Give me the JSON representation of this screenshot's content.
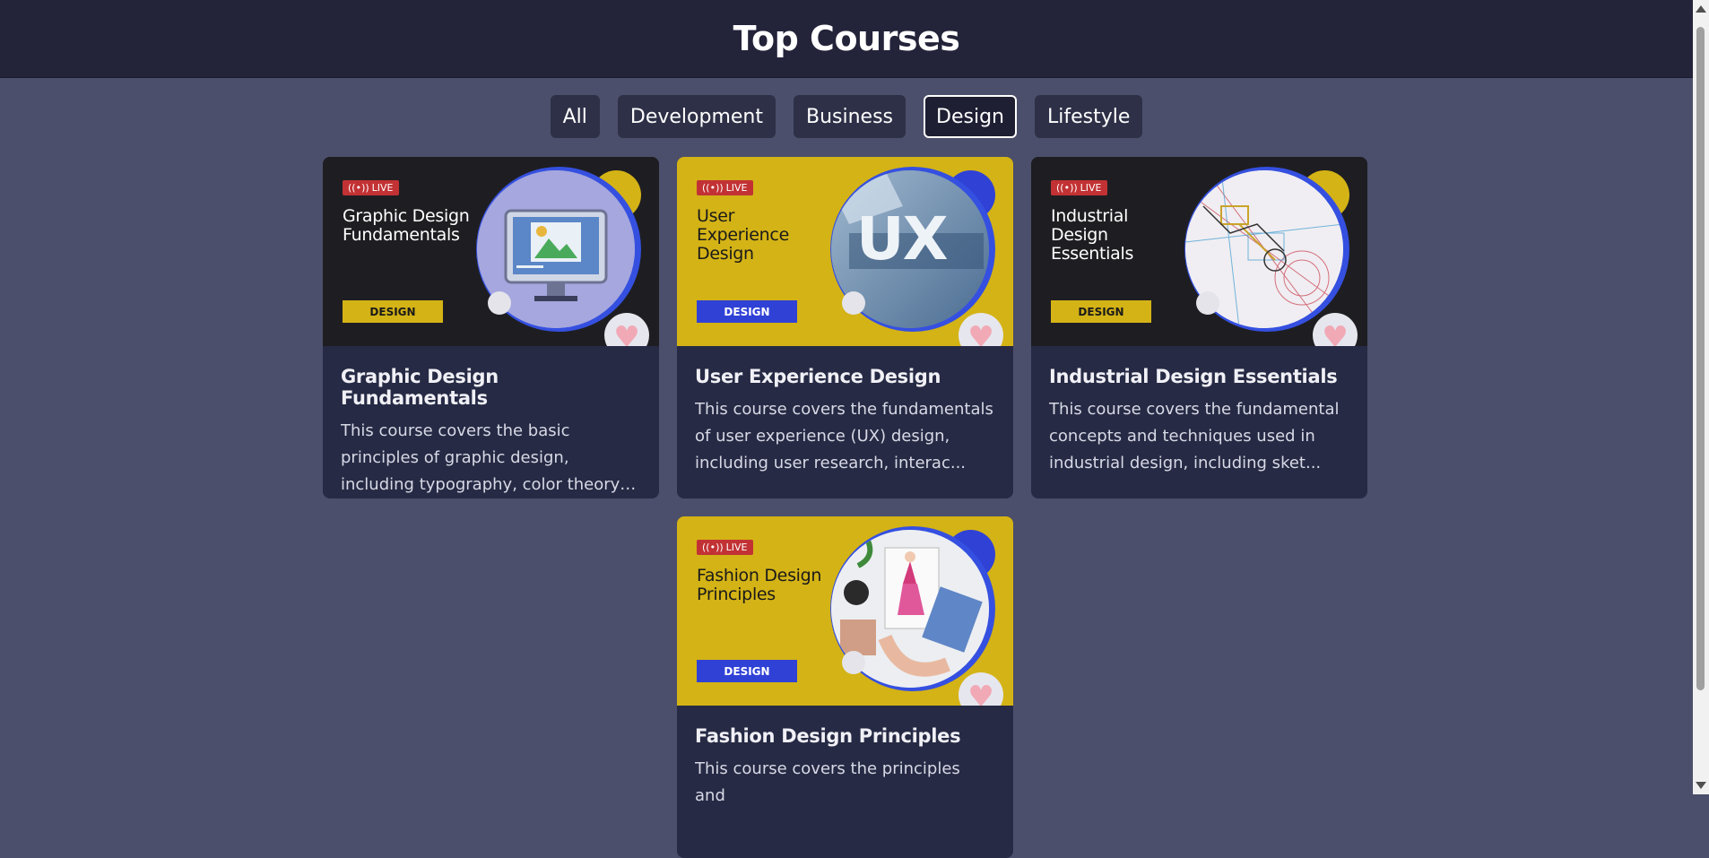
{
  "header": {
    "title": "Top Courses"
  },
  "filters": [
    {
      "label": "All"
    },
    {
      "label": "Development"
    },
    {
      "label": "Business"
    },
    {
      "label": "Design",
      "active": true
    },
    {
      "label": "Lifestyle"
    }
  ],
  "courses": [
    {
      "live_label": "LIVE",
      "thumb_title": "Graphic Design\nFundamentals",
      "tag": "DESIGN",
      "title": "Graphic Design Fundamentals",
      "description": "This course covers the basic principles of graphic design, including typography, color theory, layou...",
      "theme": "dark",
      "icon": "heart-icon"
    },
    {
      "live_label": "LIVE",
      "thumb_title": "User\nExperience\nDesign",
      "tag": "DESIGN",
      "title": "User Experience Design",
      "description": "This course covers the fundamentals of user experience (UX) design, including user research, interac...",
      "theme": "yellow",
      "icon": "heart-icon",
      "art_text": "UX"
    },
    {
      "live_label": "LIVE",
      "thumb_title": "Industrial\nDesign\nEssentials",
      "tag": "DESIGN",
      "title": "Industrial Design Essentials",
      "description": "This course covers the fundamental concepts and techniques used in industrial design, including sket...",
      "theme": "dark",
      "icon": "heart-icon"
    },
    {
      "live_label": "LIVE",
      "thumb_title": "Fashion Design\nPrinciples",
      "tag": "DESIGN",
      "title": "Fashion Design Principles",
      "description": "This course covers the principles and",
      "theme": "yellow",
      "icon": "heart-icon"
    }
  ],
  "colors": {
    "background": "#4b4f6b",
    "header": "#23233a",
    "card": "#262a44",
    "yellow": "#d4b316",
    "blue": "#3041d6",
    "live": "#c23234"
  }
}
